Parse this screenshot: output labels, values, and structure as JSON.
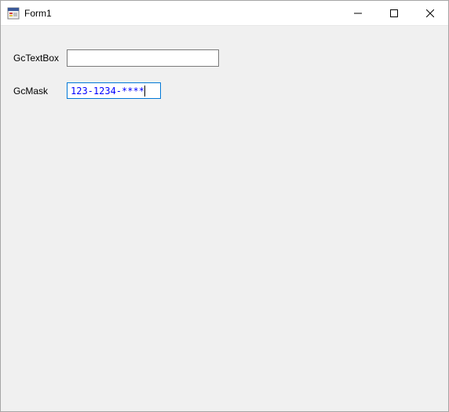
{
  "window": {
    "title": "Form1"
  },
  "fields": {
    "textbox": {
      "label": "GcTextBox",
      "value": ""
    },
    "mask": {
      "label": "GcMask",
      "value": "123-1234-****"
    }
  }
}
